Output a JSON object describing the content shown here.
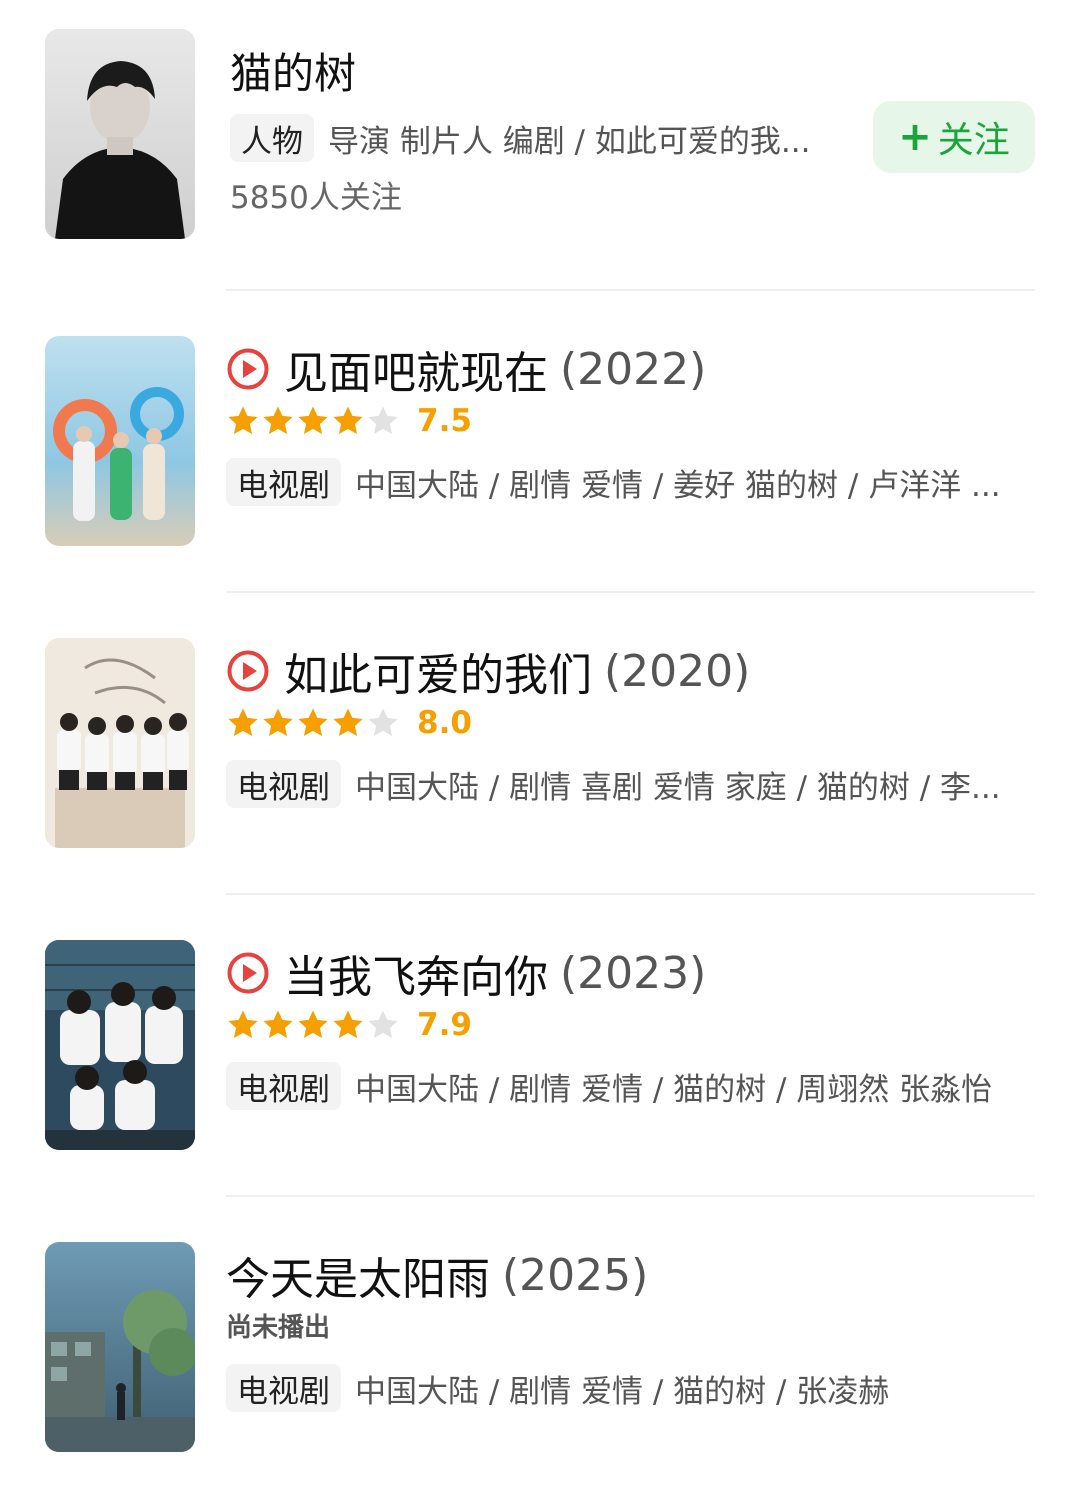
{
  "person": {
    "name": "猫的树",
    "tag": "人物",
    "roles": "导演 制片人 编剧 / 如此可爱的我...",
    "followers": "5850人关注",
    "follow_button": "关注"
  },
  "works": [
    {
      "title": "见面吧就现在",
      "year": "(2022)",
      "has_play": true,
      "rating": 7.5,
      "stars": 4,
      "type_tag": "电视剧",
      "meta": "中国大陆 / 剧情 爱情 / 姜好 猫的树 / 卢洋洋 ..."
    },
    {
      "title": "如此可爱的我们",
      "year": "(2020)",
      "has_play": true,
      "rating": 8.0,
      "stars": 4,
      "type_tag": "电视剧",
      "meta": "中国大陆 / 剧情 喜剧 爱情 家庭 / 猫的树 / 李..."
    },
    {
      "title": "当我飞奔向你",
      "year": "(2023)",
      "has_play": true,
      "rating": 7.9,
      "stars": 4,
      "type_tag": "电视剧",
      "meta": "中国大陆 / 剧情 爱情 / 猫的树 / 周翊然 张淼怡"
    },
    {
      "title": "今天是太阳雨",
      "year": "(2025)",
      "has_play": false,
      "status": "尚未播出",
      "type_tag": "电视剧",
      "meta": "中国大陆 / 剧情 爱情 / 猫的树 / 张凌赫"
    }
  ],
  "colors": {
    "accent_green": "#1aa43b",
    "follow_bg": "#e6f7ea",
    "star_gold": "#f5a000",
    "play_red": "#e8423f"
  }
}
